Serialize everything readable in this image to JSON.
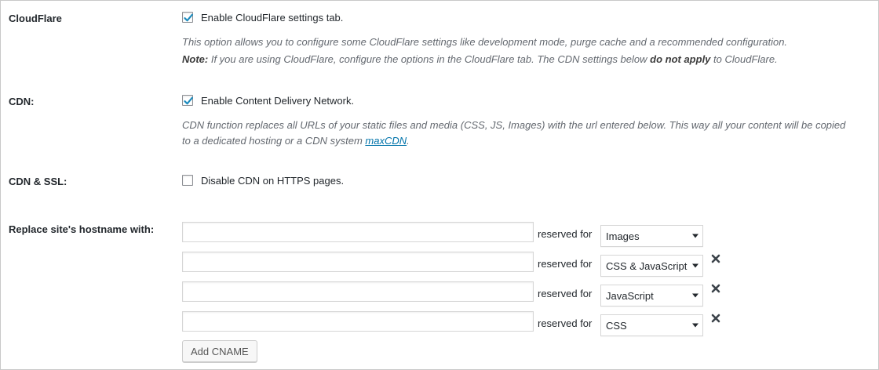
{
  "cloudflare": {
    "label": "CloudFlare",
    "checkbox_label": "Enable CloudFlare settings tab.",
    "checked": true,
    "description": "This option allows you to configure some CloudFlare settings like development mode, purge cache and a recommended configuration.",
    "note_prefix": "Note:",
    "note_text": " If you are using CloudFlare, configure the options in the CloudFlare tab. The CDN settings below ",
    "note_bold": "do not apply",
    "note_suffix": " to CloudFlare."
  },
  "cdn": {
    "label": "CDN:",
    "checkbox_label": "Enable Content Delivery Network.",
    "checked": true,
    "description_line1": "CDN function replaces all URLs of your static files and media (CSS, JS, Images) with the url entered below. This way all your content will be copied",
    "description_line2_prefix": "to a dedicated hosting or a CDN system ",
    "description_link": "maxCDN",
    "description_line2_suffix": "."
  },
  "cdn_ssl": {
    "label": "CDN & SSL:",
    "checkbox_label": "Disable CDN on HTTPS pages.",
    "checked": false
  },
  "hostname": {
    "label": "Replace site's hostname with:",
    "reserved_label": "reserved for",
    "rows": [
      {
        "value": "",
        "type": "Images",
        "removable": false
      },
      {
        "value": "",
        "type": "CSS & JavaScript",
        "removable": true
      },
      {
        "value": "",
        "type": "JavaScript",
        "removable": true
      },
      {
        "value": "",
        "type": "CSS",
        "removable": true
      }
    ],
    "add_button": "Add CNAME"
  },
  "icons": {
    "check": "checkmark-icon",
    "caret": "caret-down-icon",
    "remove": "close-icon"
  },
  "colors": {
    "check": "#1e8cbe",
    "link": "#0073aa",
    "description": "#646970"
  }
}
